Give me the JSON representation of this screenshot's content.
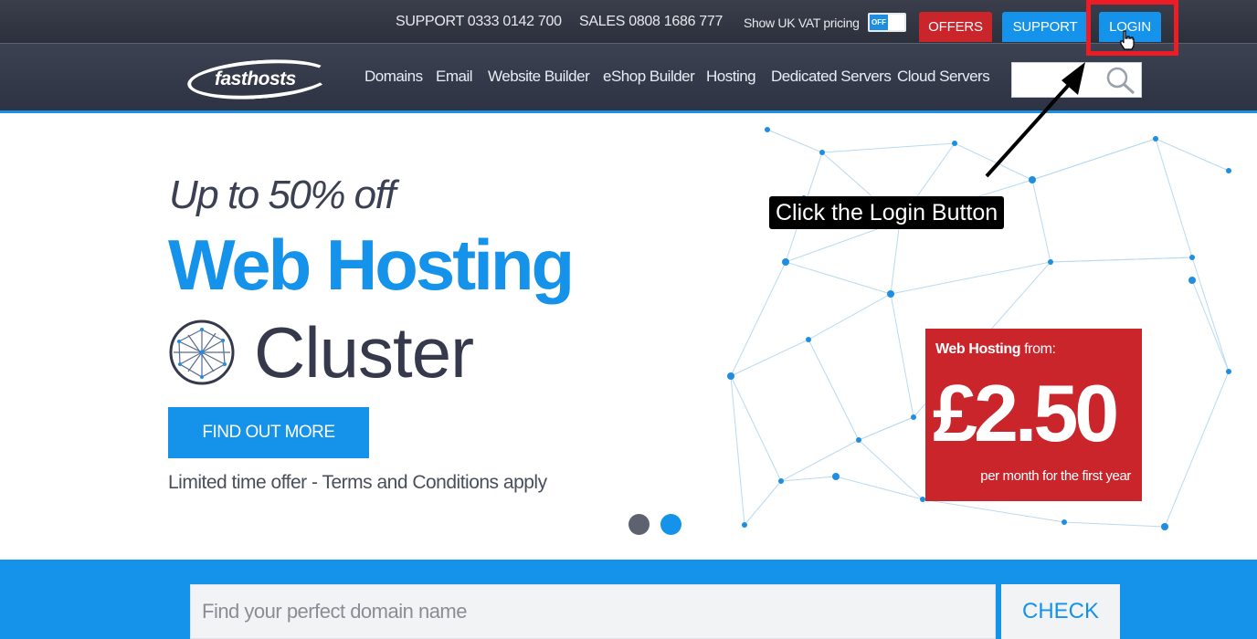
{
  "topbar": {
    "support": "SUPPORT  0333 0142 700",
    "sales": "SALES  0808 1686 777",
    "vat_label": "Show UK VAT pricing",
    "vat_toggle": "OFF",
    "offers": "OFFERS",
    "support_btn": "SUPPORT",
    "login": "LOGIN"
  },
  "nav": {
    "logo": "fasthosts",
    "items": [
      "Domains",
      "Email",
      "Website Builder",
      "eShop Builder",
      "Hosting",
      "Dedicated Servers",
      "Cloud Servers"
    ]
  },
  "hero": {
    "subtitle": "Up to 50% off",
    "title": "Web Hosting",
    "cluster": "Cluster",
    "cta": "FIND OUT MORE",
    "terms": "Limited time offer - Terms and Conditions apply"
  },
  "price": {
    "label_bold": "Web Hosting",
    "label_rest": " from:",
    "value": "£2.50",
    "note": "per month for the first year"
  },
  "annotation": "Click the Login Button",
  "domain": {
    "placeholder": "Find your perfect domain name",
    "check": "CHECK"
  },
  "colors": {
    "brand_blue": "#1592ea",
    "offer_red": "#c9252b",
    "nav_dark": "#2e3344",
    "highlight_red": "#ee1c24"
  }
}
